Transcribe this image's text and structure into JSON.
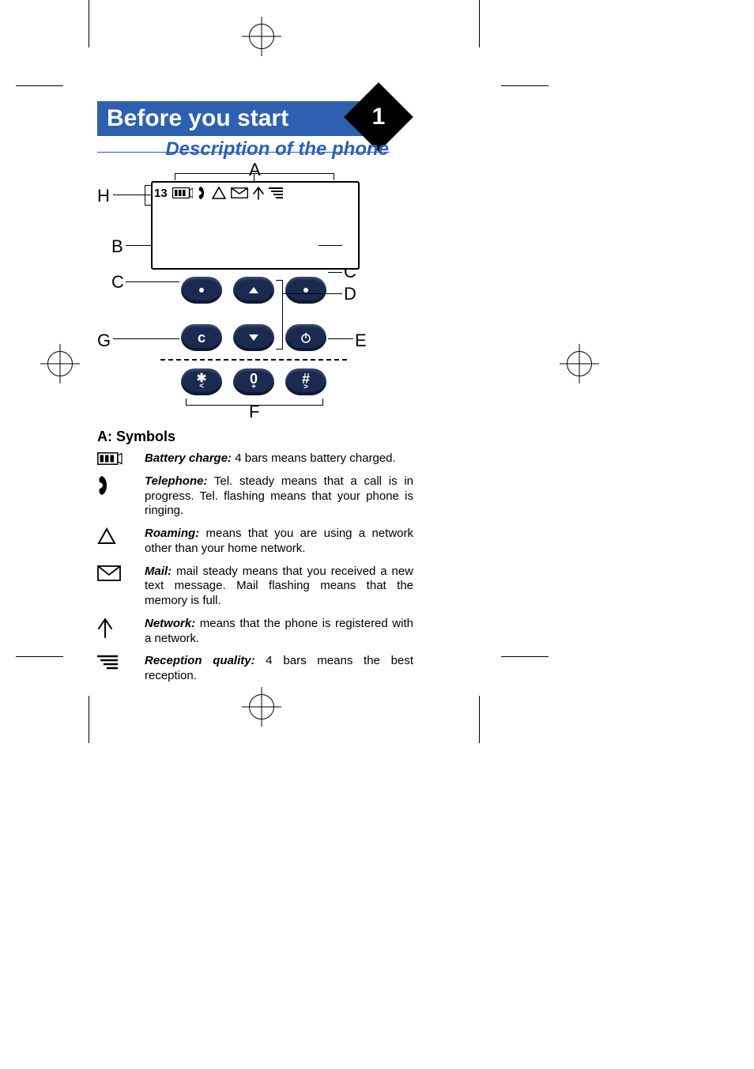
{
  "title": "Before you start",
  "chapter": "1",
  "subtitle": "Description of the phone",
  "diagram_labels": {
    "A": "A",
    "B": "B",
    "C": "C",
    "D": "D",
    "E": "E",
    "F": "F",
    "G": "G",
    "H": "H"
  },
  "status_bar": {
    "time": "13"
  },
  "keys": {
    "c": "c",
    "zero": "0",
    "star": "✱",
    "hash": "#",
    "star_sub": "<",
    "zero_sub": "+",
    "hash_sub": ">"
  },
  "symbols_heading": "A: Symbols",
  "symbols": [
    {
      "title": "Battery charge:",
      "body": " 4 bars means battery charged."
    },
    {
      "title": "Telephone:",
      "body": " Tel. steady means that a call is in progress. Tel. flashing means that your phone is rin­ging."
    },
    {
      "title": "Roaming:",
      "body": " means that you are using a network other than your home network."
    },
    {
      "title": "Mail:",
      "body": " mail steady means that you received a new text message. Mail flashing means that the memory is full."
    },
    {
      "title": "Network:",
      "body": " means that the phone is registered with a network."
    },
    {
      "title": "Reception quality:",
      "body": " 4 bars means the best reception."
    }
  ]
}
